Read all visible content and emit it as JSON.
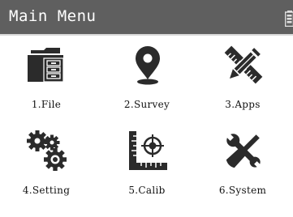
{
  "header": {
    "title": "Main Menu",
    "status_icon": "battery-icon"
  },
  "menu": {
    "items": [
      {
        "label": "1.File",
        "icon": "file-cabinet-icon"
      },
      {
        "label": "2.Survey",
        "icon": "location-pin-icon"
      },
      {
        "label": "3.Apps",
        "icon": "pencil-ruler-icon"
      },
      {
        "label": "4.Setting",
        "icon": "gears-icon"
      },
      {
        "label": "5.Calib",
        "icon": "calibration-target-icon"
      },
      {
        "label": "6.System",
        "icon": "wrench-screwdriver-icon"
      }
    ]
  },
  "colors": {
    "titlebar": "#5f5f5f",
    "icon": "#2b2b2b",
    "background": "#ffffff"
  }
}
